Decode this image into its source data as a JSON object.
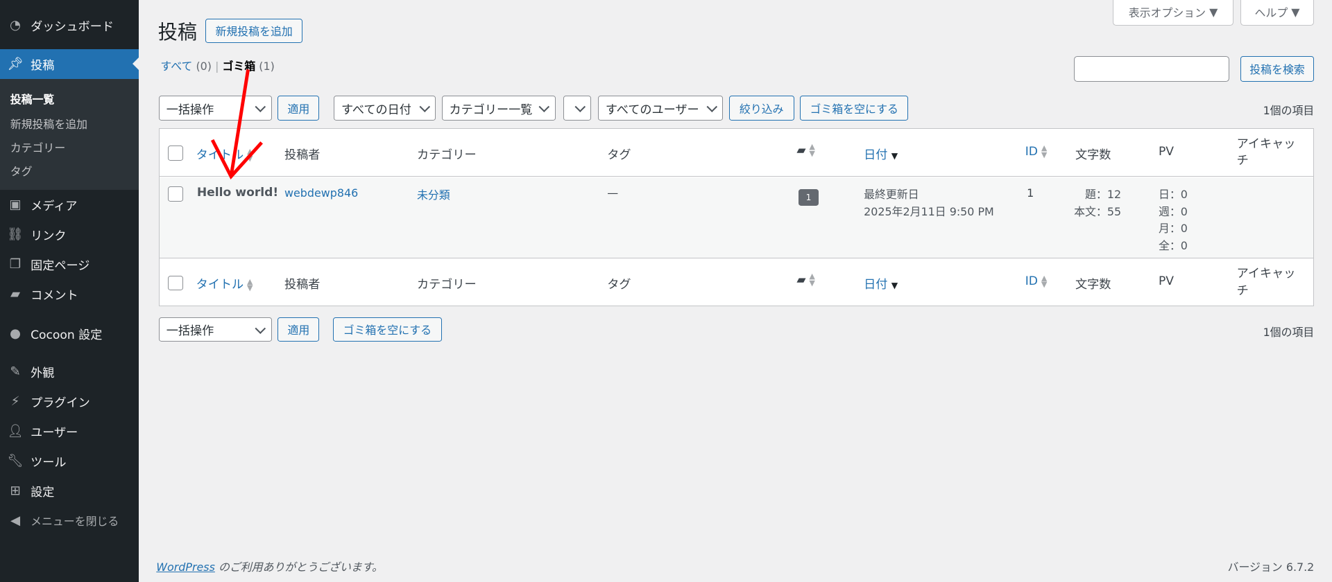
{
  "sidebar": {
    "items": [
      {
        "label": "ダッシュボード",
        "icon": "dashboard-icon"
      },
      {
        "label": "投稿",
        "icon": "pin-icon",
        "active": true
      },
      {
        "label": "メディア",
        "icon": "media-icon"
      },
      {
        "label": "リンク",
        "icon": "link-icon"
      },
      {
        "label": "固定ページ",
        "icon": "pages-icon"
      },
      {
        "label": "コメント",
        "icon": "comment-icon"
      },
      {
        "label": "Cocoon 設定",
        "icon": "cocoon-icon"
      },
      {
        "label": "外観",
        "icon": "brush-icon"
      },
      {
        "label": "プラグイン",
        "icon": "plugin-icon"
      },
      {
        "label": "ユーザー",
        "icon": "user-icon"
      },
      {
        "label": "ツール",
        "icon": "wrench-icon"
      },
      {
        "label": "設定",
        "icon": "settings-icon"
      },
      {
        "label": "メニューを閉じる",
        "icon": "collapse-icon"
      }
    ],
    "submenu": [
      "投稿一覧",
      "新規投稿を追加",
      "カテゴリー",
      "タグ"
    ]
  },
  "header": {
    "title": "投稿",
    "add_new": "新規投稿を追加",
    "screen_options": "表示オプション",
    "help": "ヘルプ"
  },
  "views": {
    "all": "すべて",
    "all_count": "(0)",
    "trash": "ゴミ箱",
    "trash_count": "(1)"
  },
  "search": {
    "value": "",
    "button": "投稿を検索"
  },
  "tablenav": {
    "bulk": "一括操作",
    "apply": "適用",
    "dates": "すべての日付",
    "categories": "カテゴリー一覧",
    "blank": "",
    "users": "すべてのユーザー",
    "filter": "絞り込み",
    "empty_trash": "ゴミ箱を空にする",
    "count": "1個の項目"
  },
  "columns": {
    "title": "タイトル",
    "author": "投稿者",
    "category": "カテゴリー",
    "tag": "タグ",
    "date": "日付",
    "id": "ID",
    "chars": "文字数",
    "pv": "PV",
    "eyecatch": "アイキャッチ"
  },
  "rows": [
    {
      "title": "Hello world!",
      "author": "webdewp846",
      "category": "未分類",
      "tag": "—",
      "comments": "1",
      "date_label": "最終更新日",
      "date": "2025年2月11日 9:50 PM",
      "id": "1",
      "chars_title": "題：12",
      "chars_body": "本文：55",
      "pv_day": "日：0",
      "pv_week": "週：0",
      "pv_month": "月：0",
      "pv_all": "全：0"
    }
  ],
  "footer": {
    "wordpress": "WordPress",
    "thanks": " のご利用ありがとうございます。",
    "version": "バージョン 6.7.2"
  },
  "colors": {
    "accent": "#2271b1",
    "sidebar": "#1d2327",
    "annotation": "#ff0000"
  }
}
